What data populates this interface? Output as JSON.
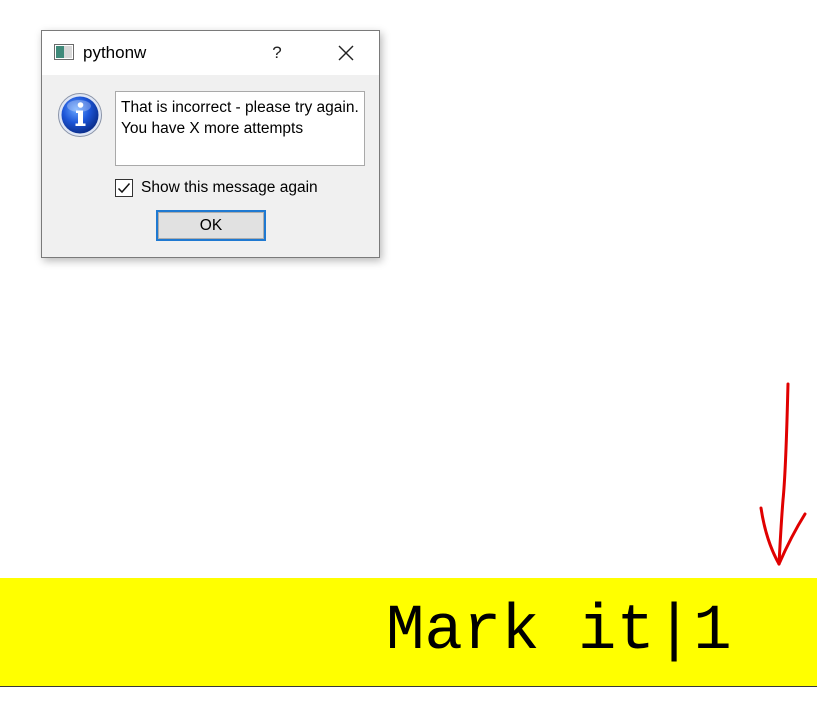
{
  "dialog": {
    "title": "pythonw",
    "help_label": "?",
    "message": "That is incorrect - please try again. You have X more attempts",
    "checkbox": {
      "label": "Show this message again",
      "checked": true
    },
    "ok_label": "OK",
    "icons": {
      "app": "window-app-icon",
      "info": "info-icon",
      "close": "close-icon"
    }
  },
  "annotation": {
    "color": "#e00000",
    "icon": "red-arrow-down-icon"
  },
  "bar": {
    "text": "Mark it|1",
    "background": "#ffff00"
  }
}
